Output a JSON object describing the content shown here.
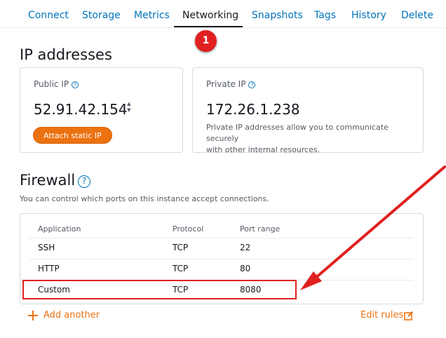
{
  "tabs": [
    {
      "label": "Connect"
    },
    {
      "label": "Storage"
    },
    {
      "label": "Metrics"
    },
    {
      "label": "Networking"
    },
    {
      "label": "Snapshots"
    },
    {
      "label": "Tags"
    },
    {
      "label": "History"
    },
    {
      "label": "Delete"
    }
  ],
  "active_tab": "Networking",
  "annotation": {
    "step_number": "1"
  },
  "ip_section": {
    "title": "IP addresses",
    "public": {
      "label": "Public IP",
      "value": "52.91.42.154",
      "button_label": "Attach static IP"
    },
    "private": {
      "label": "Private IP",
      "value": "172.26.1.238",
      "description_line1": "Private IP addresses allow you to communicate securely",
      "description_line2": "with other internal resources."
    }
  },
  "firewall": {
    "title": "Firewall",
    "help_glyph": "?",
    "description": "You can control which ports on this instance accept connections.",
    "columns": [
      "Application",
      "Protocol",
      "Port range"
    ],
    "rows": [
      {
        "application": "SSH",
        "protocol": "TCP",
        "port_range": "22"
      },
      {
        "application": "HTTP",
        "protocol": "TCP",
        "port_range": "80"
      },
      {
        "application": "Custom",
        "protocol": "TCP",
        "port_range": "8080"
      }
    ],
    "add_label": "Add another",
    "edit_label": "Edit rules"
  },
  "colors": {
    "link_blue": "#0073bb",
    "accent_orange": "#ec7211",
    "annotation_red": "#e02020"
  },
  "icons": {
    "help": "question-circle-icon",
    "add": "plus-icon",
    "edit": "edit-icon",
    "annotation_arrow": "red-arrow"
  }
}
